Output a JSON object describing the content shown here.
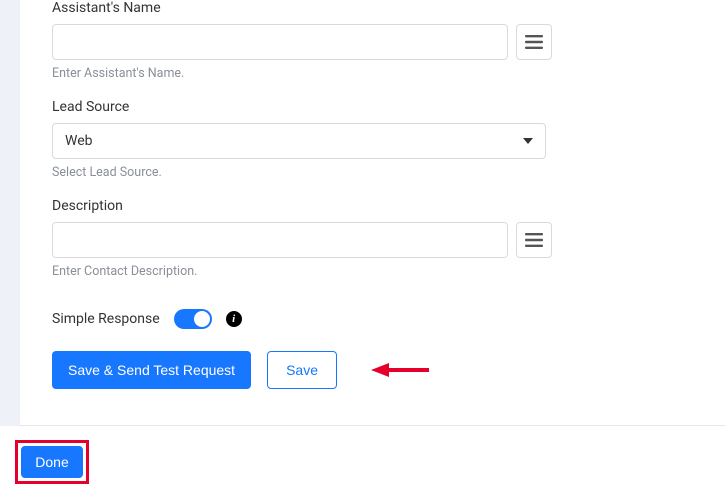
{
  "fields": {
    "assistant": {
      "label": "Assistant's Name",
      "help": "Enter Assistant's Name."
    },
    "leadSource": {
      "label": "Lead Source",
      "value": "Web",
      "help": "Select Lead Source."
    },
    "description": {
      "label": "Description",
      "help": "Enter Contact Description."
    }
  },
  "simpleResponse": {
    "label": "Simple Response",
    "info": "i"
  },
  "buttons": {
    "saveSend": "Save & Send Test Request",
    "save": "Save",
    "done": "Done"
  },
  "colors": {
    "primary": "#1877ff",
    "highlight": "#e4002b"
  }
}
